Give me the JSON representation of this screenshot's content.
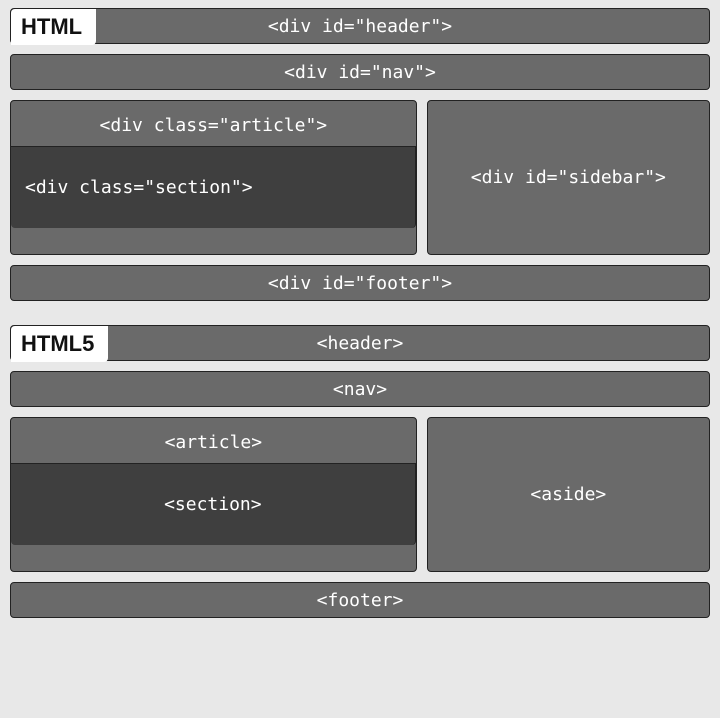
{
  "html4": {
    "title": "HTML",
    "header": "<div id=\"header\">",
    "nav": "<div id=\"nav\">",
    "article": "<div class=\"article\">",
    "section": "<div class=\"section\">",
    "sidebar": "<div id=\"sidebar\">",
    "footer": "<div id=\"footer\">"
  },
  "html5": {
    "title": "HTML5",
    "header": "<header>",
    "nav": "<nav>",
    "article": "<article>",
    "section": "<section>",
    "aside": "<aside>",
    "footer": "<footer>"
  }
}
